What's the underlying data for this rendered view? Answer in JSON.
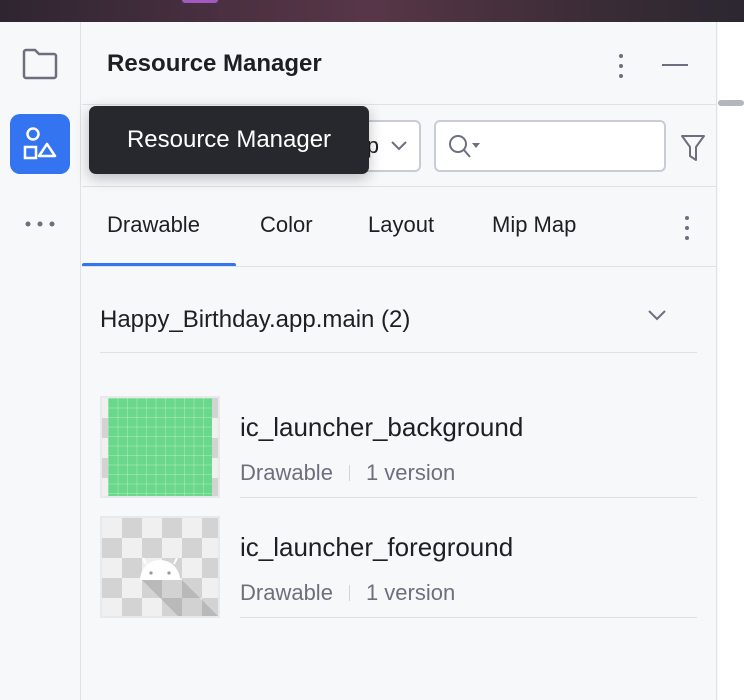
{
  "panel": {
    "title": "Resource Manager"
  },
  "tooltip": {
    "text": "Resource Manager"
  },
  "toolbar": {
    "module_select_value": "app",
    "search_value": ""
  },
  "tabs": [
    {
      "label": "Drawable",
      "active": true
    },
    {
      "label": "Color"
    },
    {
      "label": "Layout"
    },
    {
      "label": "Mip Map"
    }
  ],
  "group": {
    "label": "Happy_Birthday.app.main (2)"
  },
  "resources": [
    {
      "name": "ic_launcher_background",
      "type": "Drawable",
      "versions": "1 version"
    },
    {
      "name": "ic_launcher_foreground",
      "type": "Drawable",
      "versions": "1 version"
    }
  ],
  "colors": {
    "accent": "#3574f0",
    "tooltip_bg": "#27282e",
    "thumb_green": "#6ad88a"
  }
}
